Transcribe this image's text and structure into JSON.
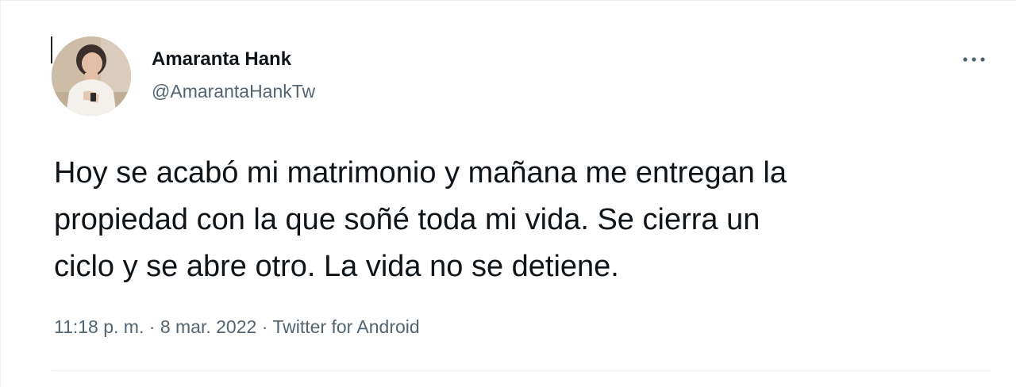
{
  "author": {
    "display_name": "Amaranta Hank",
    "handle": "@AmarantaHankTw"
  },
  "more_icon": "more-horizontal-icon",
  "tweet": {
    "lines": [
      "Hoy se acabó mi matrimonio y mañana me entregan la",
      "propiedad con la que soñé toda mi vida. Se cierra un",
      "ciclo y se abre otro. La vida no se detiene."
    ]
  },
  "meta": {
    "time": "11:18 p. m.",
    "separator": "·",
    "date": "8 mar. 2022",
    "source": "Twitter for Android"
  },
  "colors": {
    "text_primary": "#0f1419",
    "text_secondary": "#536471",
    "divider": "#e6ecf0"
  }
}
